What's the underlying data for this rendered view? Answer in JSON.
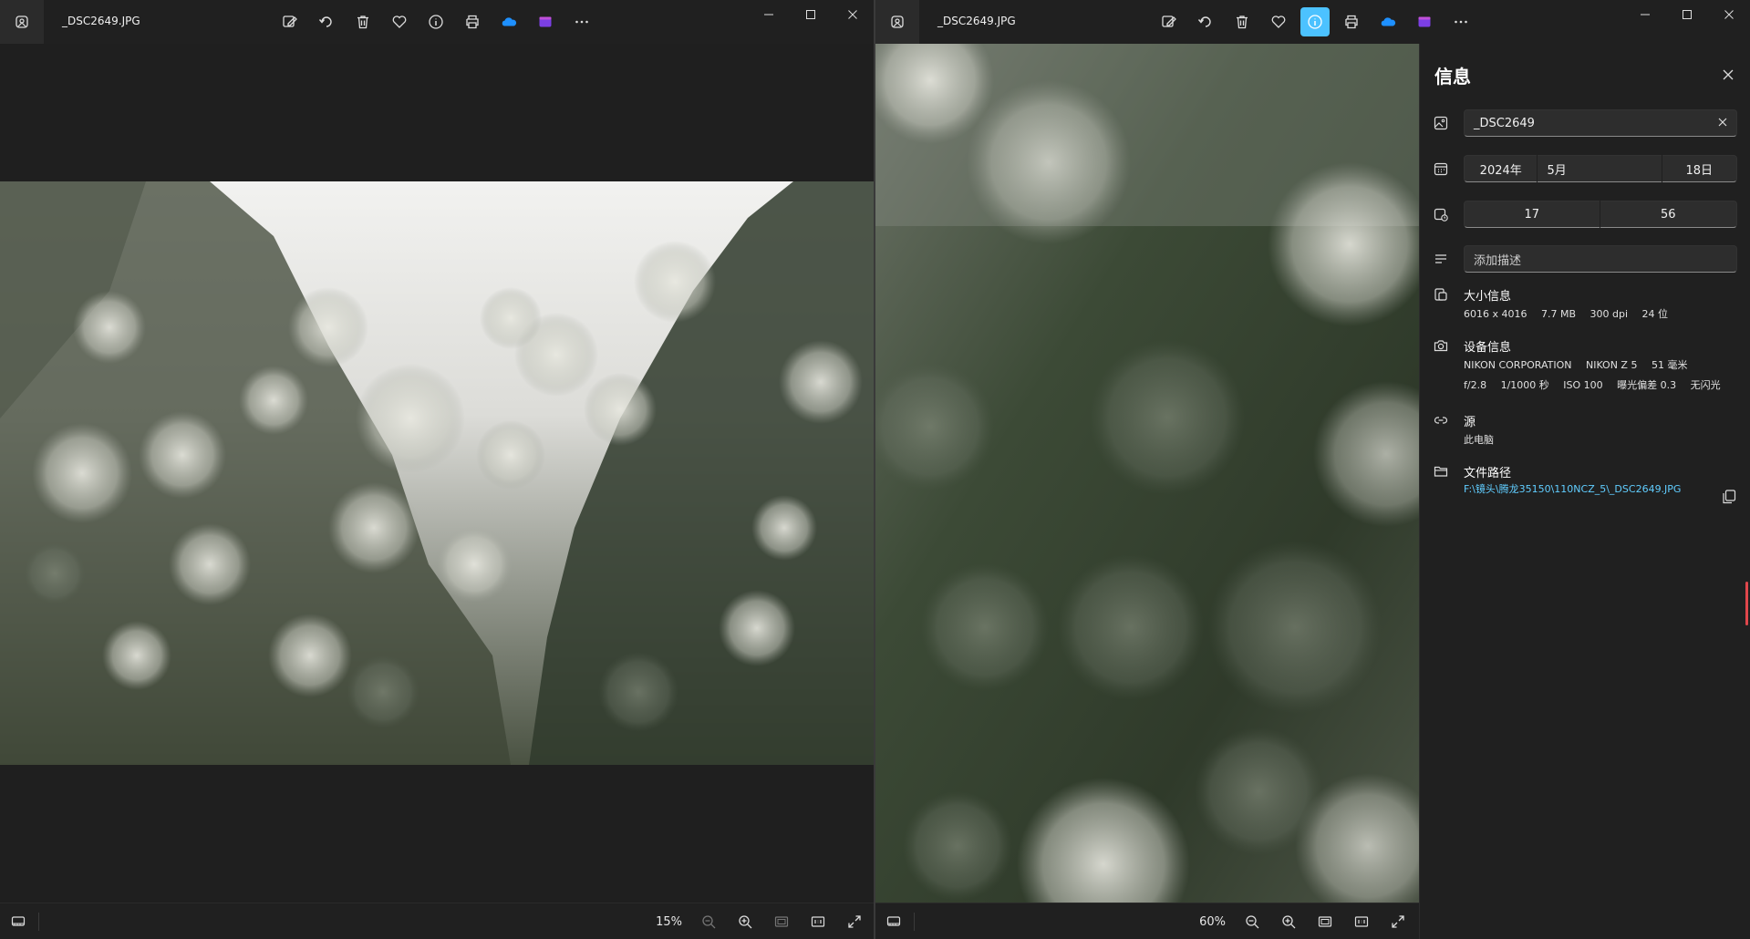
{
  "left": {
    "title": "_DSC2649.JPG",
    "zoom": "15%"
  },
  "right": {
    "title": "_DSC2649.JPG",
    "zoom": "60%"
  },
  "info": {
    "title": "信息",
    "file_name": "_DSC2649",
    "date": {
      "year": "2024年",
      "month": "5月",
      "day": "18日"
    },
    "time": {
      "hour": "17",
      "minute": "56"
    },
    "description_placeholder": "添加描述",
    "size": {
      "title": "大小信息",
      "dimensions": "6016 x 4016",
      "filesize": "7.7 MB",
      "dpi": "300 dpi",
      "bitdepth": "24 位"
    },
    "device": {
      "title": "设备信息",
      "maker": "NIKON CORPORATION",
      "model": "NIKON Z 5",
      "focal": "51 毫米",
      "aperture": "f/2.8",
      "shutter": "1/1000 秒",
      "iso": "ISO 100",
      "exposure_bias": "曝光偏差 0.3",
      "flash": "无闪光"
    },
    "source": {
      "title": "源",
      "value": "此电脑"
    },
    "path": {
      "title": "文件路径",
      "value": "F:\\镜头\\腾龙35150\\110NCZ_5\\_DSC2649.JPG"
    }
  },
  "colors": {
    "accent": "#4cc2ff",
    "link": "#60cdff",
    "background": "#1f1f1f"
  },
  "icons": [
    "photos-app-icon",
    "edit-icon",
    "rotate-icon",
    "delete-icon",
    "favorite-icon",
    "info-icon",
    "print-icon",
    "onedrive-icon",
    "clipchamp-icon",
    "more-icon",
    "filmstrip-icon",
    "zoom-out-icon",
    "zoom-in-icon",
    "fit-icon",
    "actual-size-icon",
    "fullscreen-icon"
  ]
}
